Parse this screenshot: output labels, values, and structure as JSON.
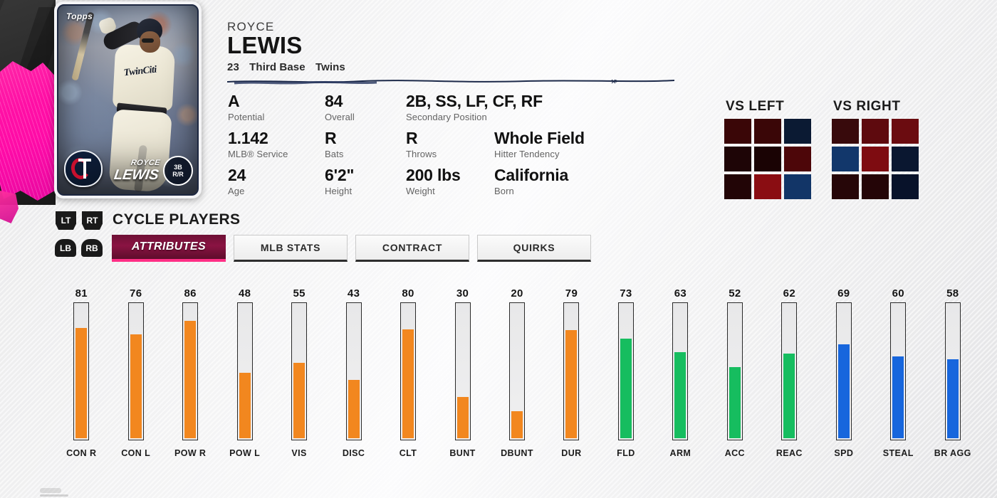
{
  "card": {
    "brand": "Topps",
    "first_name": "ROYCE",
    "last_name": "LEWIS",
    "position_badge_line1": "3B",
    "position_badge_line2": "R/R",
    "team_script": "TwinCiti",
    "team_logo": "twins-logo"
  },
  "player": {
    "first_name": "ROYCE",
    "last_name": "LEWIS",
    "jersey_number": "23",
    "position": "Third Base",
    "team": "Twins"
  },
  "bio": [
    {
      "value": "A",
      "label": "Potential"
    },
    {
      "value": "84",
      "label": "Overall"
    },
    {
      "value": "2B, SS, LF, CF, RF",
      "label": "Secondary Position"
    },
    {
      "value": "1.142",
      "label": "MLB® Service"
    },
    {
      "value": "R",
      "label": "Bats"
    },
    {
      "value": "R",
      "label": "Throws"
    },
    {
      "value": "Whole Field",
      "label": "Hitter Tendency"
    },
    {
      "value": "24",
      "label": "Age"
    },
    {
      "value": "6'2\"",
      "label": "Height"
    },
    {
      "value": "200 lbs",
      "label": "Weight"
    },
    {
      "value": "California",
      "label": "Born"
    }
  ],
  "heatmaps": [
    {
      "title": "VS LEFT",
      "cells": [
        "#3a0607",
        "#3a0607",
        "#0b1a33",
        "#1e0506",
        "#1a0304",
        "#4d0609",
        "#220506",
        "#8a0d12",
        "#123567"
      ]
    },
    {
      "title": "VS RIGHT",
      "cells": [
        "#380a0c",
        "#5e0a0e",
        "#6b0c10",
        "#12376b",
        "#7e0c11",
        "#0a1730",
        "#260608",
        "#240507",
        "#08122a"
      ]
    }
  ],
  "controls": {
    "cycle_label": "CYCLE PLAYERS",
    "trigger_left": "LT",
    "trigger_right": "RT",
    "bumper_left": "LB",
    "bumper_right": "RB"
  },
  "tabs": [
    {
      "label": "ATTRIBUTES",
      "active": true
    },
    {
      "label": "MLB STATS",
      "active": false
    },
    {
      "label": "CONTRACT",
      "active": false
    },
    {
      "label": "QUIRKS",
      "active": false
    }
  ],
  "colors": {
    "hitting": "#f2871f",
    "fielding": "#16bd5f",
    "running": "#1766dd",
    "accent_pink": "#ff2f86",
    "tab_active_bg": "#8a1342"
  },
  "chart_data": {
    "type": "bar",
    "title": "ATTRIBUTES",
    "ylim": [
      0,
      99
    ],
    "categories": [
      "CON R",
      "CON L",
      "POW R",
      "POW L",
      "VIS",
      "DISC",
      "CLT",
      "BUNT",
      "DBUNT",
      "DUR",
      "FLD",
      "ARM",
      "ACC",
      "REAC",
      "SPD",
      "STEAL",
      "BR AGG"
    ],
    "values": [
      81,
      76,
      86,
      48,
      55,
      43,
      80,
      30,
      20,
      79,
      73,
      63,
      52,
      62,
      69,
      60,
      58
    ],
    "colors": [
      "#f2871f",
      "#f2871f",
      "#f2871f",
      "#f2871f",
      "#f2871f",
      "#f2871f",
      "#f2871f",
      "#f2871f",
      "#f2871f",
      "#f2871f",
      "#16bd5f",
      "#16bd5f",
      "#16bd5f",
      "#16bd5f",
      "#1766dd",
      "#1766dd",
      "#1766dd"
    ],
    "groups": [
      "hitting",
      "hitting",
      "hitting",
      "hitting",
      "hitting",
      "hitting",
      "hitting",
      "hitting",
      "hitting",
      "hitting",
      "fielding",
      "fielding",
      "fielding",
      "fielding",
      "running",
      "running",
      "running"
    ]
  }
}
